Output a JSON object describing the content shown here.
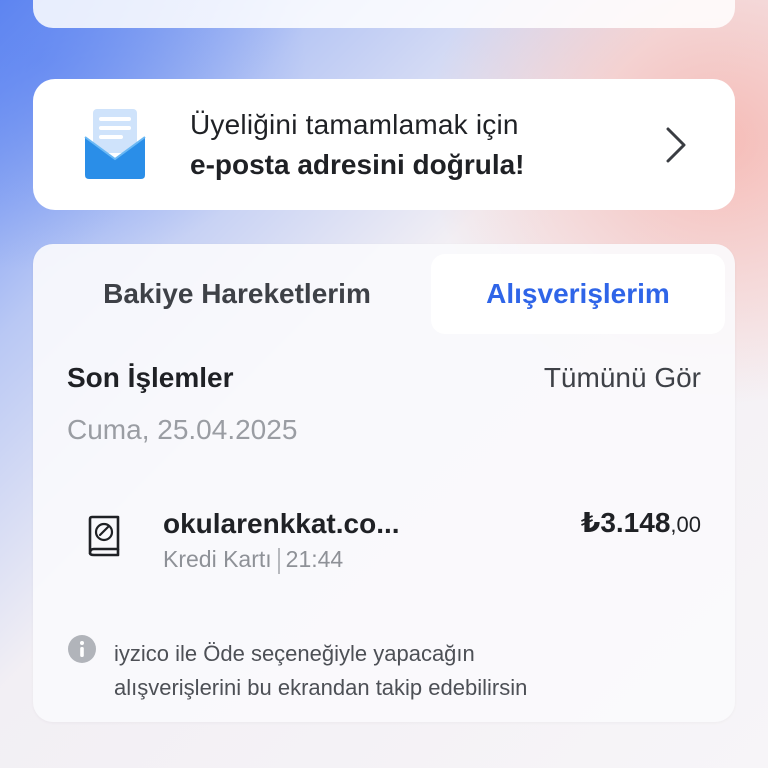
{
  "verify_banner": {
    "line1": "Üyeliğini tamamlamak için",
    "line2": "e-posta adresini doğrula!",
    "icon": "envelope-icon"
  },
  "tabs": [
    {
      "label": "Bakiye Hareketlerim",
      "active": false
    },
    {
      "label": "Alışverişlerim",
      "active": true
    }
  ],
  "recent": {
    "title": "Son İşlemler",
    "see_all": "Tümünü Gör",
    "date": "Cuma, 25.04.2025",
    "transactions": [
      {
        "merchant": "okularenkkat.co...",
        "method": "Kredi Kartı",
        "time": "21:44",
        "amount_main": "₺3.148",
        "amount_decimal": ",00",
        "icon": "book-icon"
      }
    ]
  },
  "info": {
    "line1": "iyzico ile Öde seçeneğiyle yapacağın",
    "line2": "alışverişlerini bu ekrandan takip edebilirsin"
  },
  "colors": {
    "accent": "#2f65e8",
    "text": "#1f2125",
    "muted": "#9a9da3"
  }
}
